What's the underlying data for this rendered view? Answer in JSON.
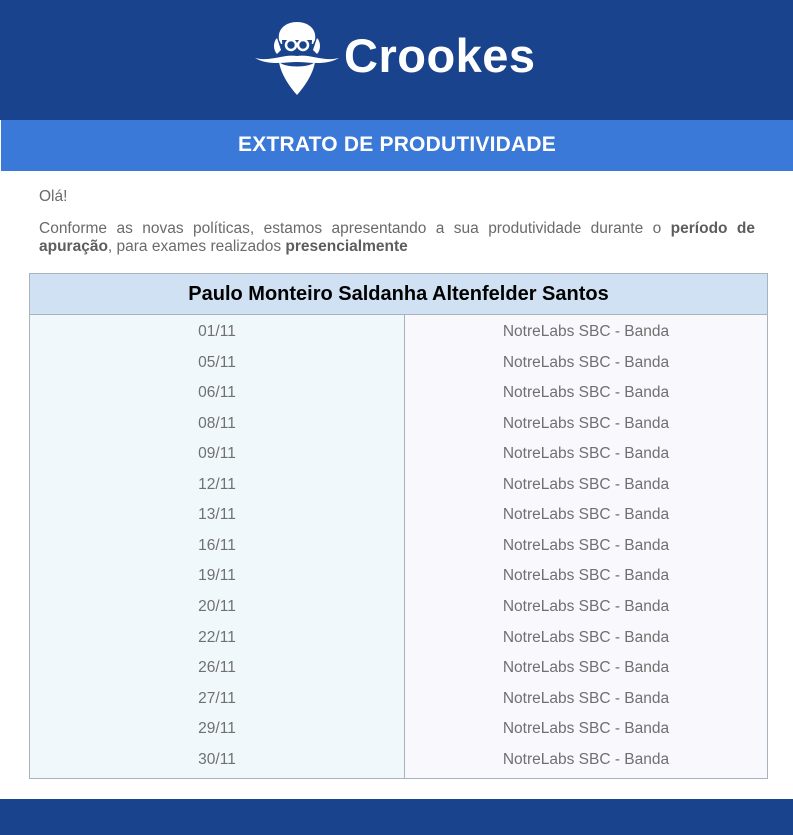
{
  "brand": {
    "name": "Crookes"
  },
  "title": "EXTRATO DE PRODUTIVIDADE",
  "greeting": "Olá!",
  "intro": {
    "part1": "Conforme as novas políticas, estamos apresentando a sua produtividade durante o ",
    "bold1": "período de apuração",
    "part2": ", para exames realizados ",
    "bold2": "presencialmente"
  },
  "table": {
    "person_name": "Paulo Monteiro Saldanha Altenfelder Santos",
    "rows": [
      {
        "date": "01/11",
        "location": "NotreLabs SBC - Banda"
      },
      {
        "date": "05/11",
        "location": "NotreLabs SBC - Banda"
      },
      {
        "date": "06/11",
        "location": "NotreLabs SBC - Banda"
      },
      {
        "date": "08/11",
        "location": "NotreLabs SBC - Banda"
      },
      {
        "date": "09/11",
        "location": "NotreLabs SBC - Banda"
      },
      {
        "date": "12/11",
        "location": "NotreLabs SBC - Banda"
      },
      {
        "date": "13/11",
        "location": "NotreLabs SBC - Banda"
      },
      {
        "date": "16/11",
        "location": "NotreLabs SBC - Banda"
      },
      {
        "date": "19/11",
        "location": "NotreLabs SBC - Banda"
      },
      {
        "date": "20/11",
        "location": "NotreLabs SBC - Banda"
      },
      {
        "date": "22/11",
        "location": "NotreLabs SBC - Banda"
      },
      {
        "date": "26/11",
        "location": "NotreLabs SBC - Banda"
      },
      {
        "date": "27/11",
        "location": "NotreLabs SBC - Banda"
      },
      {
        "date": "29/11",
        "location": "NotreLabs SBC - Banda"
      },
      {
        "date": "30/11",
        "location": "NotreLabs SBC - Banda"
      }
    ]
  },
  "colors": {
    "header_bg": "#1a438d",
    "title_bar_bg": "#3a79d8",
    "name_row_bg": "#cfe1f2",
    "text_gray": "#6a6a6a"
  },
  "icons": {
    "logo": "scientist-face-logo-icon"
  }
}
